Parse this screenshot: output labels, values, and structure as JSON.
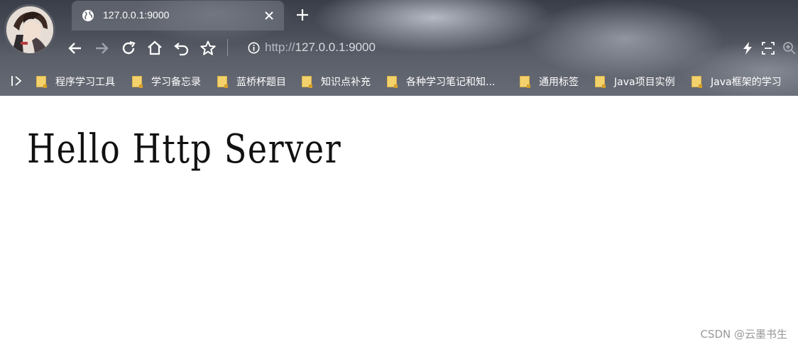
{
  "tab": {
    "title": "127.0.0.1:9000"
  },
  "address_bar": {
    "protocol": "http://",
    "host": "127.0.0.1:9000"
  },
  "bookmarks": [
    "程序学习工具",
    "学习备忘录",
    "蓝桥杯题目",
    "知识点补充",
    "各种学习笔记和知...",
    "通用标签",
    "Java项目实例",
    "Java框架的学习"
  ],
  "page": {
    "heading": "Hello Http Server"
  },
  "watermark": "CSDN @云墨书生",
  "icons": {
    "tab": "globe-icon",
    "close": "close-icon",
    "new_tab": "plus-icon",
    "back": "back-arrow-icon",
    "forward": "forward-arrow-icon",
    "reload": "reload-icon",
    "home": "home-icon",
    "undo": "undo-icon",
    "star": "star-icon",
    "info": "info-icon",
    "bolt": "lightning-icon",
    "screenshot": "screenshot-icon",
    "zoom": "zoom-icon",
    "bookmark_folder": "folder-icon"
  },
  "colors": {
    "chrome_dark": "#3a3e48",
    "folder": "#f3d26c",
    "watermark": "#999999"
  }
}
